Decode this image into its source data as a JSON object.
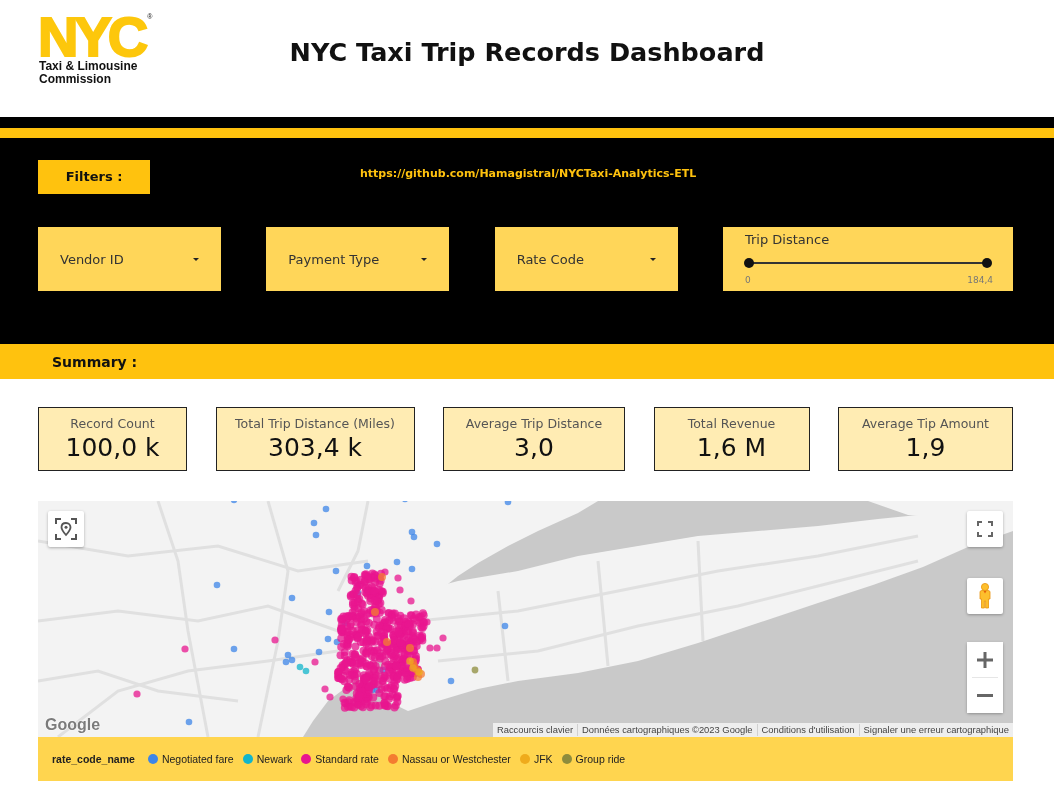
{
  "header": {
    "logo": {
      "mark": "NYC",
      "registered": "®",
      "lines": [
        "Taxi & Limousine",
        "Commission"
      ]
    },
    "title": "NYC Taxi Trip Records Dashboard"
  },
  "filters": {
    "label": "Filters :",
    "link": "https://github.com/Hamagistral/NYCTaxi-Analytics-ETL",
    "controls": [
      {
        "kind": "dropdown",
        "label": "Vendor ID"
      },
      {
        "kind": "dropdown",
        "label": "Payment Type"
      },
      {
        "kind": "dropdown",
        "label": "Rate Code"
      },
      {
        "kind": "range_slider",
        "label": "Trip Distance",
        "level": 1,
        "min_label": "0",
        "max_label": "184,4"
      }
    ]
  },
  "summary": {
    "label": "Summary :",
    "kpis": [
      {
        "label": "Record Count",
        "value": "100,0 k"
      },
      {
        "label": "Total Trip Distance (Miles)",
        "value": "303,4 k"
      },
      {
        "label": "Average Trip Distance",
        "value": "3,0"
      },
      {
        "label": "Total Revenue",
        "value": "1,6 M"
      },
      {
        "label": "Average Tip Amount",
        "value": "1,9"
      }
    ]
  },
  "map": {
    "provider_logo": "Google",
    "attribution_links": [
      "Raccourcis clavier",
      "Données cartographiques ©2023 Google",
      "Conditions d'utilisation",
      "Signaler une erreur cartographique"
    ],
    "legend": {
      "title": "rate_code_name",
      "items": [
        {
          "label": "Negotiated fare",
          "color": "#3d86e8"
        },
        {
          "label": "Newark",
          "color": "#12b5cb"
        },
        {
          "label": "Standard rate",
          "color": "#e8158f"
        },
        {
          "label": "Nassau or Westchester",
          "color": "#f47c30"
        },
        {
          "label": "JFK",
          "color": "#efab1c"
        },
        {
          "label": "Group ride",
          "color": "#8e8c3c"
        }
      ]
    }
  }
}
